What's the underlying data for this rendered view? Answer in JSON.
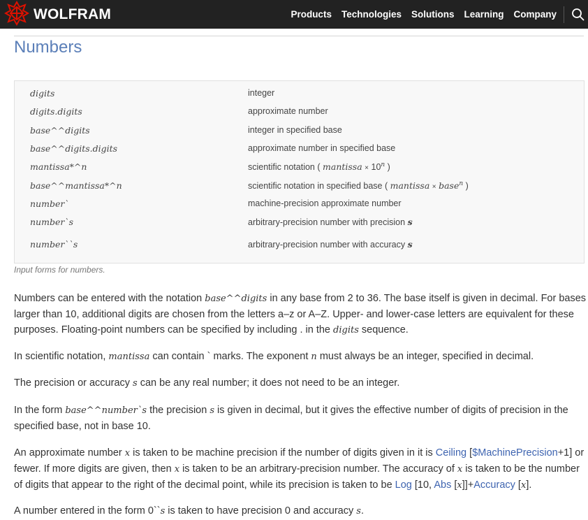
{
  "header": {
    "logo_text": "WOLFRAM",
    "nav": [
      "Products",
      "Technologies",
      "Solutions",
      "Learning",
      "Company"
    ],
    "search_icon": "search-icon",
    "colors": {
      "bar": "#222222",
      "logo": "#dd1100"
    }
  },
  "page": {
    "title": "Numbers",
    "title_color": "#5b7fb8"
  },
  "table": {
    "rows": [
      {
        "form": "digits",
        "desc": "integer"
      },
      {
        "form": "digits.digits",
        "desc": "approximate number"
      },
      {
        "form": "base^^digits",
        "desc": "integer in specified base"
      },
      {
        "form": "base^^digits.digits",
        "desc": "approximate number in specified base"
      },
      {
        "form": "mantissa*^n",
        "desc": "scientific notation",
        "math": [
          "mantissa",
          "×",
          "10",
          "n"
        ]
      },
      {
        "form": "base^^mantissa*^n",
        "desc": "scientific notation in specified base",
        "math": [
          "mantissa",
          "×",
          "base",
          "n"
        ]
      },
      {
        "form": "number`",
        "desc": "machine-precision approximate number"
      },
      {
        "form": "number`s",
        "desc": "arbitrary-precision number with precision",
        "var": "s"
      },
      {
        "form": "number``s",
        "desc": "arbitrary-precision number with accuracy",
        "var": "s"
      }
    ],
    "caption": "Input forms for numbers."
  },
  "paragraphs": {
    "p1": {
      "a": "Numbers can be entered with the notation ",
      "v1": "base^^digits",
      "b": " in any base from 2 to 36. The base itself is given in decimal. For bases larger than 10, additional digits are chosen from the letters a–z or A–Z. Upper- and lower-case letters are equivalent for these purposes. Floating-point numbers can be specified by including . in the ",
      "v2": "digits",
      "c": " sequence."
    },
    "p2": {
      "a": "In scientific notation, ",
      "v1": "mantissa",
      "b": " can contain ` marks. The exponent ",
      "v2": "n",
      "c": " must always be an integer, specified in decimal."
    },
    "p3": {
      "a": "The precision or accuracy ",
      "v1": "s",
      "b": " can be any real number; it does not need to be an integer."
    },
    "p4": {
      "a": "In the form ",
      "v1": "base^^number`s",
      "b": " the precision ",
      "v2": "s",
      "c": " is given in decimal, but it gives the effective number of digits of precision in the specified base, not in base 10."
    },
    "p5": {
      "a": "An approximate number ",
      "v1": "x",
      "b": " is taken to be machine precision if the number of digits given in it is ",
      "l1": "Ceiling",
      "b2": " [",
      "l2": "$MachinePrecision",
      "b3": "+1] or fewer. If more digits are given, then ",
      "v2": "x",
      "c": " is taken to be an arbitrary-precision number. The accuracy of ",
      "v3": "x",
      "d": " is taken to be the number of digits that appear to the right of the decimal point, while its precision is taken to be ",
      "l3": "Log",
      "e": " [10, ",
      "l4": "Abs",
      "f": " [",
      "v4": "x",
      "g": "]]+",
      "l5": "Accuracy",
      "h": " [",
      "v5": "x",
      "i": "]."
    },
    "p6": {
      "a": "A number entered in the form 0``",
      "v1": "s",
      "b": " is taken to have precision 0 and accuracy ",
      "v2": "s",
      "c": "."
    }
  }
}
